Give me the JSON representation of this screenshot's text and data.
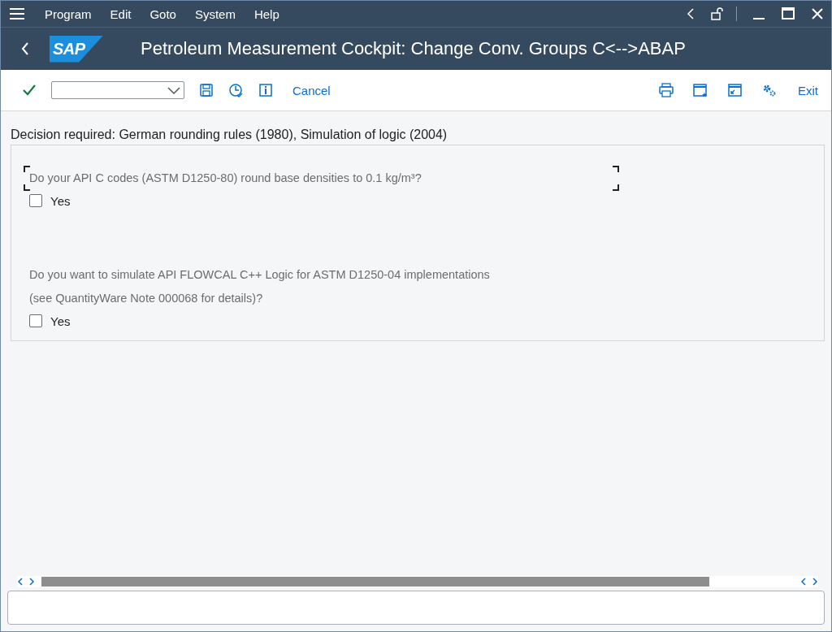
{
  "menu": [
    {
      "label": "Program"
    },
    {
      "label": "Edit"
    },
    {
      "label": "Goto"
    },
    {
      "label": "System"
    },
    {
      "label": "Help"
    }
  ],
  "title_bar": {
    "logo": "SAP",
    "title": "Petroleum Measurement Cockpit: Change Conv. Groups C<-->ABAP"
  },
  "toolbar": {
    "cancel": "Cancel",
    "exit": "Exit"
  },
  "heading": "Decision required: German rounding rules (1980), Simulation of logic (2004)",
  "questions": [
    {
      "lines": [
        "Do your API C codes (ASTM D1250-80) round base densities to 0.1 kg/m³?"
      ],
      "focused": true,
      "checkbox": {
        "label": "Yes",
        "checked": false
      }
    },
    {
      "lines": [
        "Do you want to simulate API FLOWCAL C++ Logic for ASTM D1250-04 implementations",
        "(see QuantityWare Note 000068 for details)?"
      ],
      "focused": false,
      "checkbox": {
        "label": "Yes",
        "checked": false
      }
    }
  ]
}
